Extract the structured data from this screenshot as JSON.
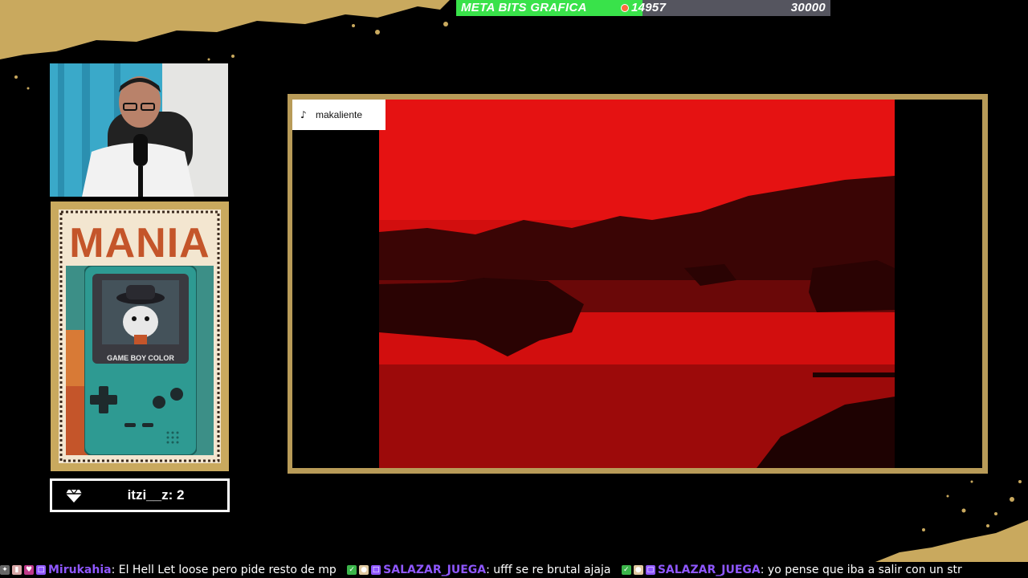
{
  "goal": {
    "title": "META BITS GRAFICA",
    "current": "14957",
    "target": "30000",
    "progress": 0.4986,
    "fill_color": "#39e24a",
    "track_color": "#55555f"
  },
  "tiktok": {
    "username": "makaliente",
    "icon": "tiktok-icon"
  },
  "poster": {
    "title": "MANIA",
    "device_label": "GAME BOY COLOR",
    "title_color": "#c4552a",
    "device_color": "#2e9a92"
  },
  "counter": {
    "icon": "diamond-icon",
    "text": "itzi__z: 2"
  },
  "chat": {
    "user_color": "#8f57ff",
    "messages": [
      {
        "user": "Mirukahia",
        "text": ": El Hell Let loose pero pide resto de mp"
      },
      {
        "user": "SALAZAR_JUEGA",
        "text": ": ufff se re brutal ajaja"
      },
      {
        "user": "SALAZAR_JUEGA",
        "text": ": yo pense que iba a salir con un str"
      }
    ]
  },
  "colors": {
    "gold": "#c9a95e",
    "video_red": "#d20e0e"
  }
}
